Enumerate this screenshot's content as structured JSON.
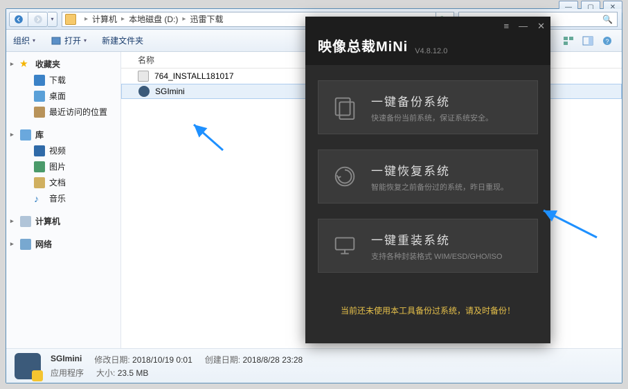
{
  "breadcrumb": {
    "root": "计算机",
    "drive": "本地磁盘 (D:)",
    "folder": "迅雷下载"
  },
  "toolbar": {
    "organize": "组织",
    "open": "打开",
    "newfolder": "新建文件夹"
  },
  "columns": {
    "name": "名称"
  },
  "sidebar": {
    "favorites": "收藏夹",
    "downloads": "下载",
    "desktop": "桌面",
    "recent": "最近访问的位置",
    "libraries": "库",
    "videos": "视频",
    "pictures": "图片",
    "documents": "文档",
    "music": "音乐",
    "computer": "计算机",
    "network": "网络"
  },
  "files": [
    {
      "name": "764_INSTALL181017",
      "type": "inst"
    },
    {
      "name": "SGImini",
      "type": "sgi"
    }
  ],
  "details": {
    "name": "SGImini",
    "type": "应用程序",
    "mod_k": "修改日期:",
    "mod_v": "2018/10/19 0:01",
    "size_k": "大小:",
    "size_v": "23.5 MB",
    "created_k": "创建日期:",
    "created_v": "2018/8/28 23:28"
  },
  "app": {
    "title_cn": "映像总裁",
    "title_en": "MiNi",
    "version": "V4.8.12.0",
    "cards": [
      {
        "title": "一键备份系统",
        "desc": "快速备份当前系统，保证系统安全。"
      },
      {
        "title": "一键恢复系统",
        "desc": "智能恢复之前备份过的系统，昨日重现。"
      },
      {
        "title": "一键重装系统",
        "desc": "支持各种封装格式 WIM/ESD/GHO/ISO"
      }
    ],
    "warning": "当前还未使用本工具备份过系统，请及时备份！"
  }
}
